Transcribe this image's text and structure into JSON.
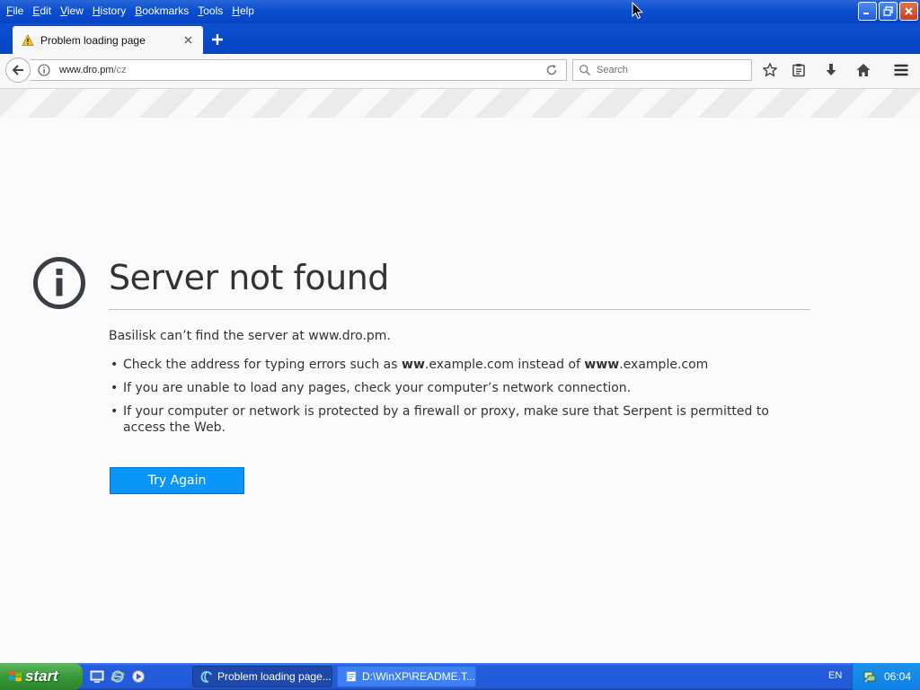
{
  "menu": {
    "items": [
      {
        "label": "File"
      },
      {
        "label": "Edit"
      },
      {
        "label": "View"
      },
      {
        "label": "History"
      },
      {
        "label": "Bookmarks"
      },
      {
        "label": "Tools"
      },
      {
        "label": "Help"
      }
    ]
  },
  "tab": {
    "title": "Problem loading page",
    "icon": "warning-icon"
  },
  "navbar": {
    "url_host": "www.dro.pm",
    "url_path": "/cz",
    "search_placeholder": "Search"
  },
  "error": {
    "title": "Server not found",
    "description": "Basilisk can’t find the server at www.dro.pm.",
    "bullet1_pre": "Check the address for typing errors such as ",
    "bullet1_b1": "ww",
    "bullet1_mid": ".example.com instead of ",
    "bullet1_b2": "www",
    "bullet1_post": ".example.com",
    "bullet2": "If you are unable to load any pages, check your computer’s network connection.",
    "bullet3": "If your computer or network is protected by a firewall or proxy, make sure that Serpent is permitted to access the Web.",
    "try_again": "Try Again"
  },
  "taskbar": {
    "start_label": "start",
    "tasks": [
      {
        "label": "Problem loading page...."
      },
      {
        "label": "D:\\WinXP\\README.T..."
      }
    ],
    "language": "EN",
    "clock": "06:04"
  },
  "colors": {
    "accent_button": "#0996f8",
    "titlebar_blue": "#0a4fd0",
    "start_green": "#379937"
  }
}
